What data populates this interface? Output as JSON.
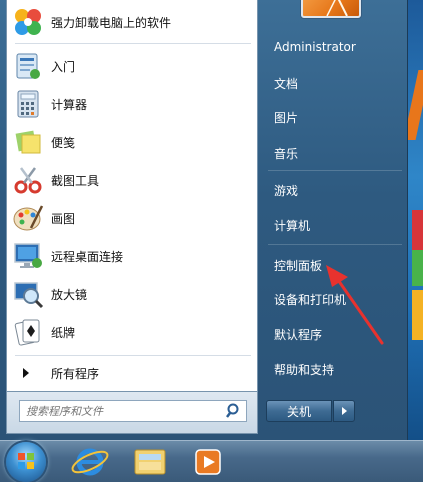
{
  "pinned_programs": [
    {
      "label": "强力卸载电脑上的软件",
      "icon": "uninstaller-icon"
    },
    {
      "label": "入门",
      "icon": "getting-started-icon"
    },
    {
      "label": "计算器",
      "icon": "calculator-icon"
    },
    {
      "label": "便笺",
      "icon": "sticky-notes-icon"
    },
    {
      "label": "截图工具",
      "icon": "snipping-tool-icon"
    },
    {
      "label": "画图",
      "icon": "paint-icon"
    },
    {
      "label": "远程桌面连接",
      "icon": "remote-desktop-icon"
    },
    {
      "label": "放大镜",
      "icon": "magnifier-icon"
    },
    {
      "label": "纸牌",
      "icon": "solitaire-icon"
    }
  ],
  "all_programs_label": "所有程序",
  "search": {
    "placeholder": "搜索程序和文件"
  },
  "right_items": [
    {
      "label": "Administrator"
    },
    {
      "label": "文档"
    },
    {
      "label": "图片"
    },
    {
      "label": "音乐"
    },
    {
      "label": "游戏"
    },
    {
      "label": "计算机"
    },
    {
      "label": "控制面板"
    },
    {
      "label": "设备和打印机"
    },
    {
      "label": "默认程序"
    },
    {
      "label": "帮助和支持"
    }
  ],
  "shutdown_label": "关机",
  "taskbar": {
    "icons": [
      "start-orb-icon",
      "internet-explorer-icon",
      "file-explorer-icon",
      "media-player-icon"
    ]
  },
  "colors": {
    "annotation_arrow": "#e8322e",
    "menu_glass": "#2e5a80"
  }
}
